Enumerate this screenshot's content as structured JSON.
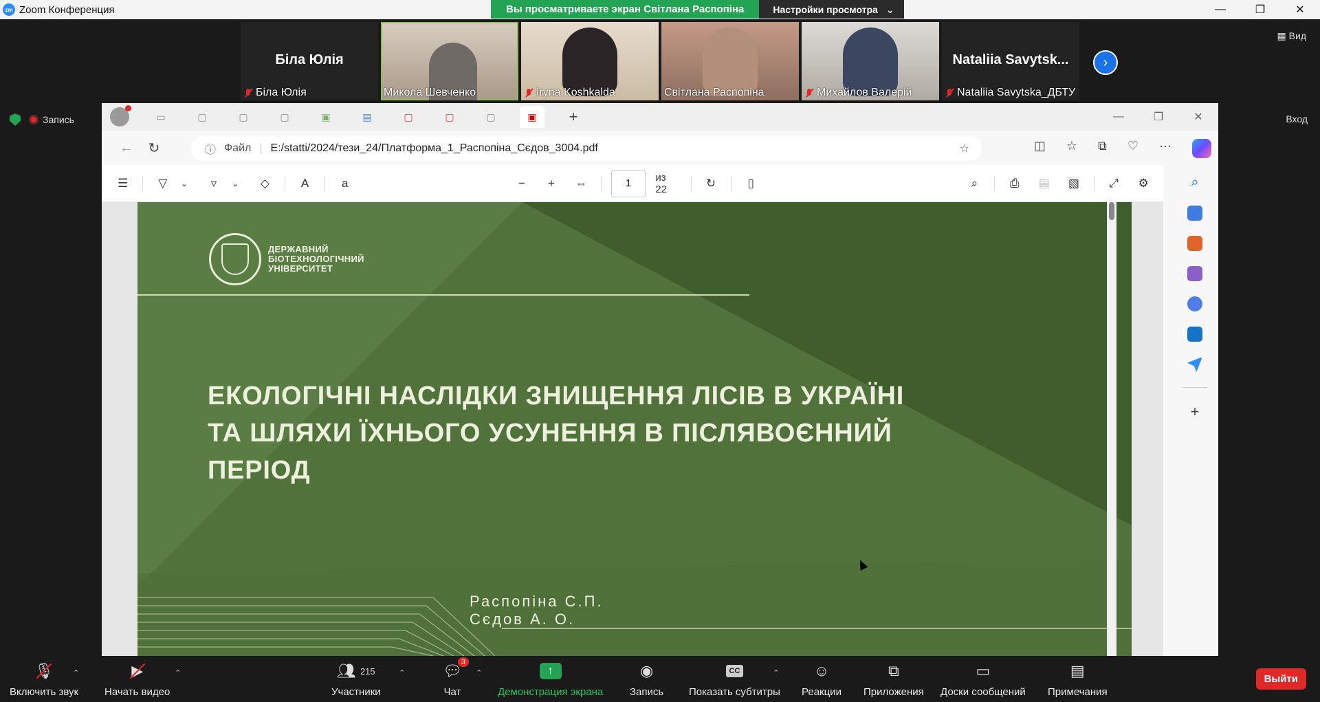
{
  "window": {
    "app_title": "Zoom Конференция",
    "share_banner": "Вы просматриваете экран Світлана Распопіна",
    "view_options": "Настройки просмотра",
    "view_button": "Вид",
    "login": "Вход",
    "record_label": "Запись"
  },
  "participants": [
    {
      "big_name": "Біла Юлія",
      "name": "Біла Юлія",
      "muted": true,
      "video": false
    },
    {
      "name": "Микола Шевченко",
      "muted": false,
      "video": true
    },
    {
      "name": "Iryna Koshkalda",
      "muted": true,
      "video": true
    },
    {
      "name": "Світлана Распопіна",
      "muted": false,
      "video": true
    },
    {
      "name": "Михайлов Валерій",
      "muted": true,
      "video": true
    },
    {
      "big_name": "Nataliia  Savytsk...",
      "name": "Nataliia Savytska_ДБТУ",
      "muted": true,
      "video": false
    }
  ],
  "browser": {
    "file_label": "Файл",
    "url": "E:/statti/2024/тези_24/Платформа_1_Распопіна_Сєдов_3004.pdf",
    "page_current": "1",
    "page_total": "из 22"
  },
  "slide": {
    "university": [
      "ДЕРЖАВНИЙ",
      "БІОТЕХНОЛОГІЧНИЙ",
      "УНІВЕРСИТЕТ"
    ],
    "title_lines": [
      "ЕКОЛОГІЧНІ НАСЛІДКИ ЗНИЩЕННЯ ЛІСІВ В УКРАЇНІ",
      "ТА ШЛЯХИ ЇХНЬОГО УСУНЕННЯ В ПІСЛЯВОЄННИЙ",
      "ПЕРІОД"
    ],
    "authors": [
      "Распопіна С.П.",
      "Сєдов А. О."
    ]
  },
  "bottom_bar": {
    "audio": "Включить звук",
    "video": "Начать видео",
    "participants": "Участники",
    "participants_count": "215",
    "chat": "Чат",
    "chat_badge": "3",
    "share": "Демонстрация экрана",
    "record": "Запись",
    "captions": "Показать субтитры",
    "reactions": "Реакции",
    "apps": "Приложения",
    "whiteboards": "Доски сообщений",
    "notes": "Примечания",
    "leave": "Выйти"
  },
  "colors": {
    "slide_green": "#5a7d43",
    "slide_dark_green": "#3f5e2c",
    "zoom_green": "#23a455",
    "leave_red": "#e02828"
  }
}
